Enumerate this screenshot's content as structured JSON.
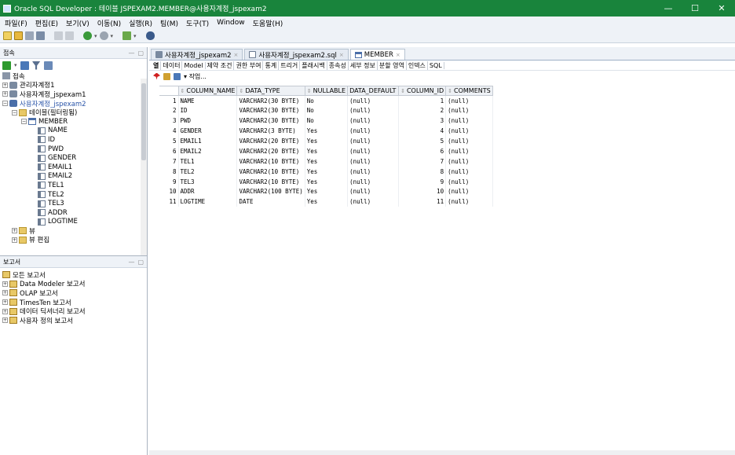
{
  "window": {
    "title": "Oracle SQL Developer : 테이블 JSPEXAM2.MEMBER@사용자계정_jspexam2",
    "controls": [
      "—",
      "☐",
      "✕"
    ]
  },
  "menu": [
    "파일(F)",
    "편집(E)",
    "보기(V)",
    "이동(N)",
    "실행(R)",
    "팀(M)",
    "도구(T)",
    "Window",
    "도움말(H)"
  ],
  "connections_panel": {
    "title": "접속",
    "root_label": "접속",
    "tree": [
      {
        "label": "관리자계정1",
        "depth": 0,
        "expander": "+",
        "icon": "database-icon"
      },
      {
        "label": "사용자계정_jspexam1",
        "depth": 0,
        "expander": "+",
        "icon": "database-icon"
      },
      {
        "label": "사용자계정_jspexam2",
        "depth": 0,
        "expander": "−",
        "icon": "database-icon",
        "selected": true
      },
      {
        "label": "테이블(필터링됨)",
        "depth": 1,
        "expander": "−",
        "icon": "folder-icon"
      },
      {
        "label": "MEMBER",
        "depth": 2,
        "expander": "−",
        "icon": "table-icon"
      },
      {
        "label": "NAME",
        "depth": 3,
        "expander": "",
        "icon": "column-icon"
      },
      {
        "label": "ID",
        "depth": 3,
        "expander": "",
        "icon": "column-icon"
      },
      {
        "label": "PWD",
        "depth": 3,
        "expander": "",
        "icon": "column-icon"
      },
      {
        "label": "GENDER",
        "depth": 3,
        "expander": "",
        "icon": "column-icon"
      },
      {
        "label": "EMAIL1",
        "depth": 3,
        "expander": "",
        "icon": "column-icon"
      },
      {
        "label": "EMAIL2",
        "depth": 3,
        "expander": "",
        "icon": "column-icon"
      },
      {
        "label": "TEL1",
        "depth": 3,
        "expander": "",
        "icon": "column-icon"
      },
      {
        "label": "TEL2",
        "depth": 3,
        "expander": "",
        "icon": "column-icon"
      },
      {
        "label": "TEL3",
        "depth": 3,
        "expander": "",
        "icon": "column-icon"
      },
      {
        "label": "ADDR",
        "depth": 3,
        "expander": "",
        "icon": "column-icon"
      },
      {
        "label": "LOGTIME",
        "depth": 3,
        "expander": "",
        "icon": "column-icon"
      },
      {
        "label": "뷰",
        "depth": 1,
        "expander": "+",
        "icon": "folder-icon"
      },
      {
        "label": "뷰 편집",
        "depth": 1,
        "expander": "+",
        "icon": "folder-icon"
      }
    ]
  },
  "reports_panel": {
    "title": "보고서",
    "root_label": "모든 보고서",
    "items": [
      "Data Modeler 보고서",
      "OLAP 보고서",
      "TimesTen 보고서",
      "데이터 딕셔너리 보고서",
      "사용자 정의 보고서"
    ]
  },
  "doc_tabs": [
    {
      "label": "사용자계정_jspexam2",
      "active": false
    },
    {
      "label": "사용자계정_jspexam2.sql",
      "active": false
    },
    {
      "label": "MEMBER",
      "active": true
    }
  ],
  "sub_tabs": [
    "열",
    "데이터",
    "Model",
    "제약 조건",
    "권한 부여",
    "통계",
    "트리거",
    "플래시백",
    "종속성",
    "세부 정보",
    "분할 영역",
    "인덱스",
    "SQL"
  ],
  "actions_label": "작업...",
  "grid": {
    "columns": [
      "COLUMN_NAME",
      "DATA_TYPE",
      "NULLABLE",
      "DATA_DEFAULT",
      "COLUMN_ID",
      "COMMENTS"
    ],
    "rows": [
      [
        "1",
        "NAME",
        "VARCHAR2(30 BYTE)",
        "No",
        "(null)",
        "1",
        "(null)"
      ],
      [
        "2",
        "ID",
        "VARCHAR2(30 BYTE)",
        "No",
        "(null)",
        "2",
        "(null)"
      ],
      [
        "3",
        "PWD",
        "VARCHAR2(30 BYTE)",
        "No",
        "(null)",
        "3",
        "(null)"
      ],
      [
        "4",
        "GENDER",
        "VARCHAR2(3 BYTE)",
        "Yes",
        "(null)",
        "4",
        "(null)"
      ],
      [
        "5",
        "EMAIL1",
        "VARCHAR2(20 BYTE)",
        "Yes",
        "(null)",
        "5",
        "(null)"
      ],
      [
        "6",
        "EMAIL2",
        "VARCHAR2(20 BYTE)",
        "Yes",
        "(null)",
        "6",
        "(null)"
      ],
      [
        "7",
        "TEL1",
        "VARCHAR2(10 BYTE)",
        "Yes",
        "(null)",
        "7",
        "(null)"
      ],
      [
        "8",
        "TEL2",
        "VARCHAR2(10 BYTE)",
        "Yes",
        "(null)",
        "8",
        "(null)"
      ],
      [
        "9",
        "TEL3",
        "VARCHAR2(10 BYTE)",
        "Yes",
        "(null)",
        "9",
        "(null)"
      ],
      [
        "10",
        "ADDR",
        "VARCHAR2(100 BYTE)",
        "Yes",
        "(null)",
        "10",
        "(null)"
      ],
      [
        "11",
        "LOGTIME",
        "DATE",
        "Yes",
        "(null)",
        "11",
        "(null)"
      ]
    ]
  },
  "colors": {
    "titlebar": "#19843c",
    "accent": "#2a54a8"
  }
}
